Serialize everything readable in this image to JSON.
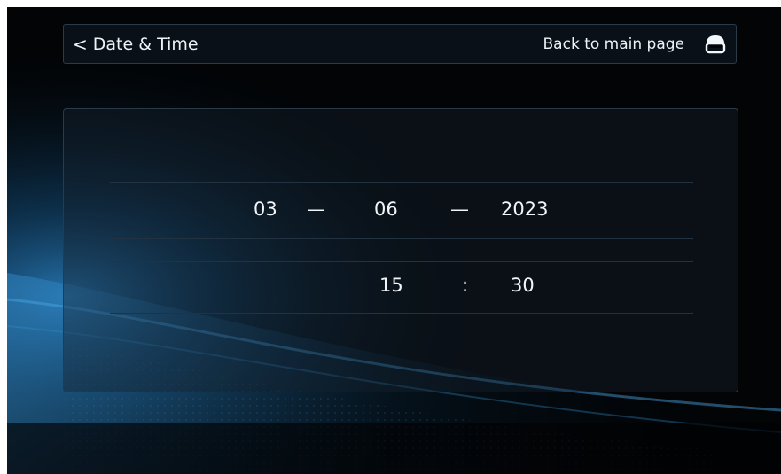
{
  "header": {
    "back_chevron": "<",
    "title": "Date & Time",
    "main_page_label": "Back to main page",
    "home_icon": "home-icon"
  },
  "date": {
    "day": "03",
    "month": "06",
    "year": "2023",
    "separator": "—"
  },
  "time": {
    "hour": "15",
    "minute": "30",
    "separator": ":"
  },
  "colors": {
    "background": "#020406",
    "accent_glow": "#1b6fb0",
    "text": "#eef3f7",
    "border": "#2b3a47"
  }
}
